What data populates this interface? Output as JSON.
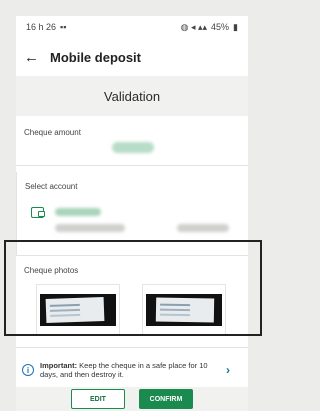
{
  "status_bar": {
    "time": "16 h 26",
    "battery": "45%"
  },
  "header": {
    "title": "Mobile deposit"
  },
  "section": {
    "title": "Validation"
  },
  "cheque_amount": {
    "label": "Cheque amount"
  },
  "account": {
    "label": "Select account"
  },
  "photos": {
    "label": "Cheque photos"
  },
  "notice": {
    "bold": "Important:",
    "text": " Keep the cheque in a safe place for 10 days, and then destroy it."
  },
  "actions": {
    "edit_label": "EDIT",
    "confirm_label": "CONFIRM"
  },
  "colors": {
    "brand_green": "#1a8a4f",
    "info_blue": "#1b6fb8"
  }
}
